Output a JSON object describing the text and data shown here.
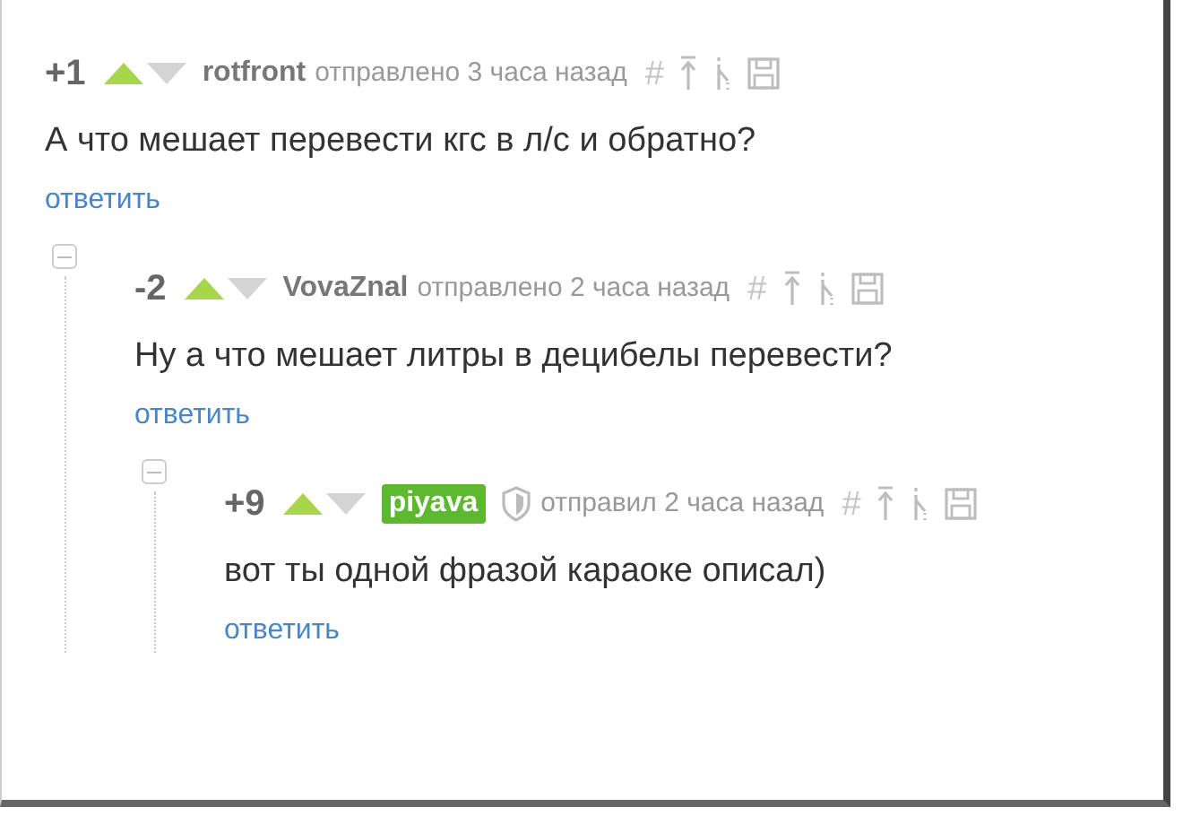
{
  "comments": [
    {
      "score": "+1",
      "author": "rotfront",
      "badge": false,
      "meta": "отправлено 3 часа назад",
      "hash": "#",
      "text": "А что мешает перевести кгс в л/с и обратно?",
      "reply": "ответить",
      "children": [
        {
          "score": "-2",
          "author": "VovaZnal",
          "badge": false,
          "meta": "отправлено 2 часа назад",
          "hash": "#",
          "text": "Ну а что мешает литры в децибелы перевести?",
          "reply": "ответить",
          "children": [
            {
              "score": "+9",
              "author": "piyava",
              "badge": true,
              "meta": "отправил 2 часа назад",
              "hash": "#",
              "text": "вот ты одной фразой караоке описал)",
              "reply": "ответить"
            }
          ]
        }
      ]
    }
  ]
}
